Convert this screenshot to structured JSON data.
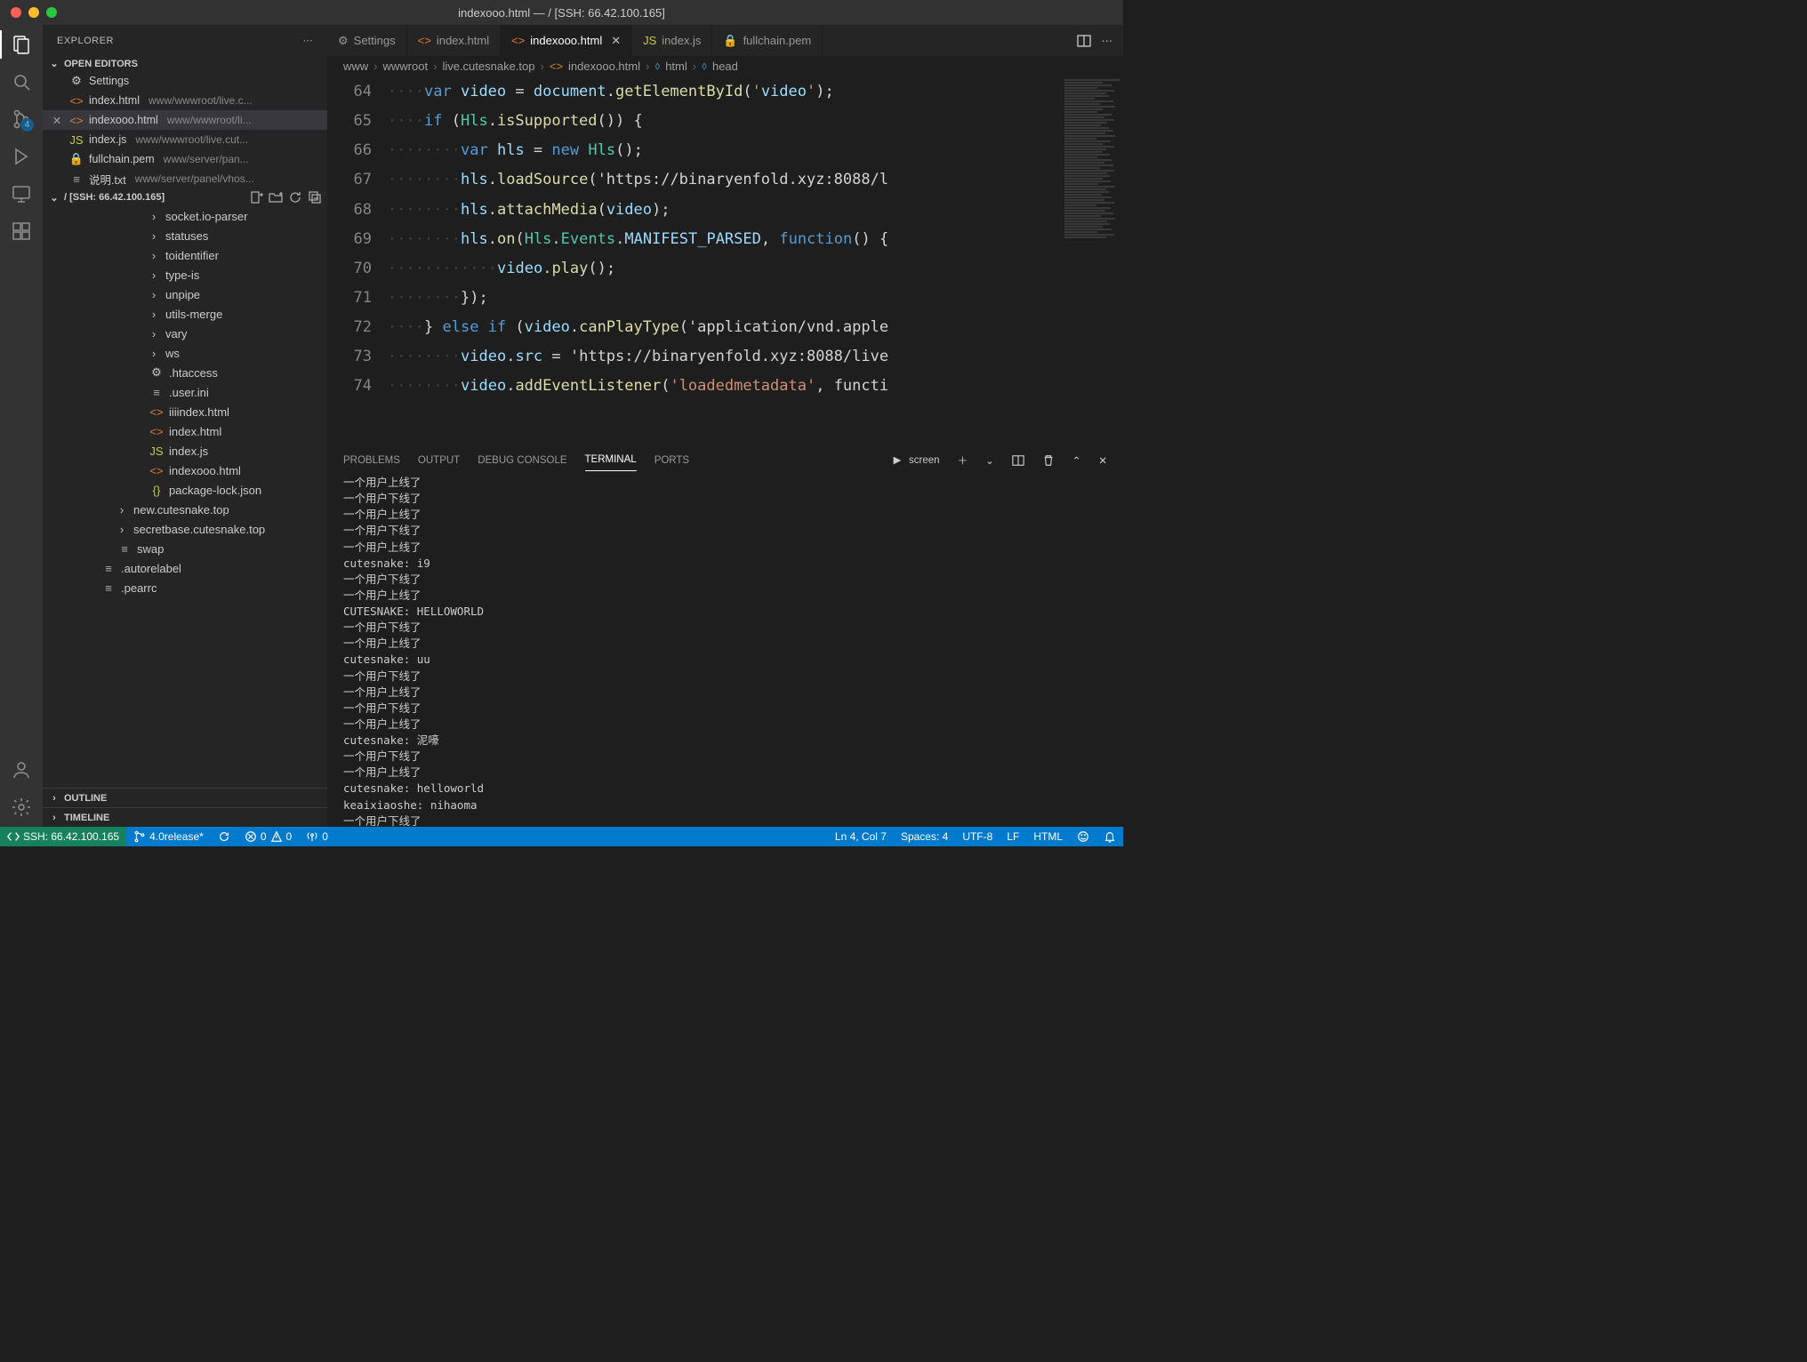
{
  "window": {
    "title": "indexooo.html — / [SSH: 66.42.100.165]"
  },
  "activity": {
    "scm_badge": "4"
  },
  "sidebar": {
    "title": "EXPLORER",
    "open_editors_label": "OPEN EDITORS",
    "open_editors": [
      {
        "icon": "gear",
        "name": "Settings",
        "hint": ""
      },
      {
        "icon": "html",
        "name": "index.html",
        "hint": "www/wwwroot/live.c..."
      },
      {
        "icon": "html",
        "name": "indexooo.html",
        "hint": "www/wwwroot/li...",
        "active": true
      },
      {
        "icon": "js",
        "name": "index.js",
        "hint": "www/wwwroot/live.cut..."
      },
      {
        "icon": "lock",
        "name": "fullchain.pem",
        "hint": "www/server/pan..."
      },
      {
        "icon": "txt",
        "name": "说明.txt",
        "hint": "www/server/panel/vhos..."
      }
    ],
    "folder_head": "/ [SSH: 66.42.100.165]",
    "tree": [
      {
        "depth": 1,
        "folder": true,
        "name": "socket.io-parser"
      },
      {
        "depth": 1,
        "folder": true,
        "name": "statuses"
      },
      {
        "depth": 1,
        "folder": true,
        "name": "toidentifier"
      },
      {
        "depth": 1,
        "folder": true,
        "name": "type-is"
      },
      {
        "depth": 1,
        "folder": true,
        "name": "unpipe"
      },
      {
        "depth": 1,
        "folder": true,
        "name": "utils-merge"
      },
      {
        "depth": 1,
        "folder": true,
        "name": "vary"
      },
      {
        "depth": 1,
        "folder": true,
        "name": "ws"
      },
      {
        "depth": 0,
        "file": true,
        "icon": "gear",
        "name": ".htaccess"
      },
      {
        "depth": 0,
        "file": true,
        "icon": "txt",
        "name": ".user.ini"
      },
      {
        "depth": 0,
        "file": true,
        "icon": "html",
        "name": "iiiindex.html"
      },
      {
        "depth": 0,
        "file": true,
        "icon": "html",
        "name": "index.html"
      },
      {
        "depth": 0,
        "file": true,
        "icon": "js",
        "name": "index.js"
      },
      {
        "depth": 0,
        "file": true,
        "icon": "html",
        "name": "indexooo.html"
      },
      {
        "depth": 0,
        "file": true,
        "icon": "json",
        "name": "package-lock.json"
      },
      {
        "depth": -1,
        "folder": true,
        "name": "new.cutesnake.top"
      },
      {
        "depth": -1,
        "folder": true,
        "name": "secretbase.cutesnake.top"
      },
      {
        "depth": -2,
        "file": true,
        "icon": "txt",
        "name": "swap"
      },
      {
        "depth": -3,
        "file": true,
        "icon": "txt",
        "name": ".autorelabel"
      },
      {
        "depth": -3,
        "file": true,
        "icon": "txt",
        "name": ".pearrc"
      }
    ],
    "outline_label": "OUTLINE",
    "timeline_label": "TIMELINE"
  },
  "tabs": [
    {
      "icon": "gear",
      "label": "Settings"
    },
    {
      "icon": "html",
      "label": "index.html"
    },
    {
      "icon": "html",
      "label": "indexooo.html",
      "active": true
    },
    {
      "icon": "js",
      "label": "index.js"
    },
    {
      "icon": "lock",
      "label": "fullchain.pem"
    }
  ],
  "breadcrumb": [
    "www",
    "wwwroot",
    "live.cutesnake.top",
    "indexooo.html",
    "html",
    "head"
  ],
  "code": {
    "start": 64,
    "lines": [
      "    var video = document.getElementById('video');",
      "    if (Hls.isSupported()) {",
      "        var hls = new Hls();",
      "        hls.loadSource('https://binaryenfold.xyz:8088/l",
      "        hls.attachMedia(video);",
      "        hls.on(Hls.Events.MANIFEST_PARSED, function() {",
      "            video.play();",
      "        });",
      "    } else if (video.canPlayType('application/vnd.apple",
      "        video.src = 'https://binaryenfold.xyz:8088/live",
      "        video.addEventListener('loadedmetadata', functi"
    ]
  },
  "panel": {
    "tabs": {
      "problems": "PROBLEMS",
      "output": "OUTPUT",
      "debug": "DEBUG CONSOLE",
      "terminal": "TERMINAL",
      "ports": "PORTS"
    },
    "terminal_name": "screen",
    "terminal_lines": [
      "一个用户上线了",
      "一个用户下线了",
      "一个用户上线了",
      "一个用户下线了",
      "一个用户上线了",
      "cutesnake: i9",
      "一个用户下线了",
      "一个用户上线了",
      "CUTESNAKE: HELLOWORLD",
      "一个用户下线了",
      "一个用户上线了",
      "cutesnake: uu",
      "一个用户下线了",
      "一个用户上线了",
      "一个用户下线了",
      "一个用户上线了",
      "cutesnake: 泥嚎",
      "一个用户下线了",
      "一个用户上线了",
      "cutesnake: helloworld",
      "keaixiaoshe: nihaoma",
      "一个用户下线了",
      "▯"
    ]
  },
  "status": {
    "remote": "SSH: 66.42.100.165",
    "branch": "4.0release*",
    "errors": "0",
    "warnings": "0",
    "live": "0",
    "cursor": "Ln 4, Col 7",
    "spaces": "Spaces: 4",
    "encoding": "UTF-8",
    "eol": "LF",
    "lang": "HTML"
  }
}
